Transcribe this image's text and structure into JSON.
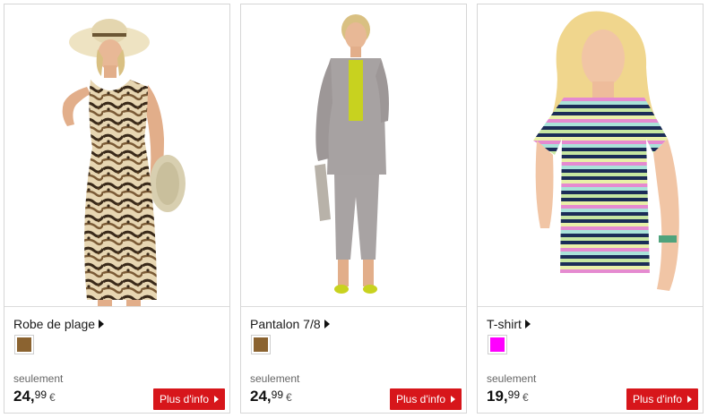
{
  "products": [
    {
      "name": "Robe de plage",
      "swatch_color": "#8b6330",
      "only_label": "seulement",
      "price_int": "24,",
      "price_dec": "99",
      "currency": "€",
      "button_label": "Plus d'info"
    },
    {
      "name": "Pantalon 7/8",
      "swatch_color": "#8b6330",
      "only_label": "seulement",
      "price_int": "24,",
      "price_dec": "99",
      "currency": "€",
      "button_label": "Plus d'info"
    },
    {
      "name": "T-shirt",
      "swatch_color": "#ff00ff",
      "only_label": "seulement",
      "price_int": "19,",
      "price_dec": "99",
      "currency": "€",
      "button_label": "Plus d'info"
    }
  ],
  "colors": {
    "accent_button": "#d7161b",
    "border": "#d6d6d6"
  }
}
